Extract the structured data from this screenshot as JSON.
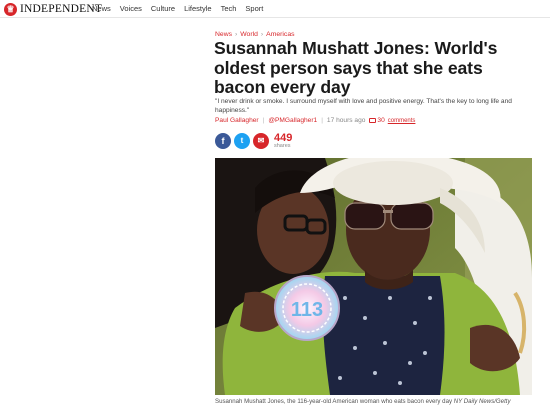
{
  "site": {
    "logo_glyph": "♕",
    "name": "INDEPENDENT"
  },
  "nav": {
    "items": [
      "News",
      "Voices",
      "Culture",
      "Lifestyle",
      "Tech",
      "Sport"
    ]
  },
  "breadcrumb": {
    "items": [
      "News",
      "World",
      "Americas"
    ],
    "separator": "›"
  },
  "article": {
    "headline": "Susannah Mushatt Jones: World's oldest person says that she eats bacon every day",
    "standfirst": "\"I never drink or smoke. I surround myself with love and positive energy. That's the key to long life and happiness.\"",
    "author": "Paul Gallagher",
    "twitter_handle": "@PMGallagher1",
    "time_ago": "17 hours ago",
    "comment_count": "30",
    "comments_label": "comments"
  },
  "share": {
    "facebook_glyph": "f",
    "twitter_glyph": "t",
    "email_glyph": "✉",
    "count": "449",
    "label": "shares"
  },
  "photo": {
    "badge_text": "113"
  },
  "caption": {
    "text": "Susannah Mushatt Jones, the 116-year-old American woman who eats bacon every day",
    "credit": "NY Daily News/Getty"
  },
  "colors": {
    "brand_red": "#d7262a",
    "facebook": "#3b5998",
    "twitter": "#1da1f2"
  }
}
